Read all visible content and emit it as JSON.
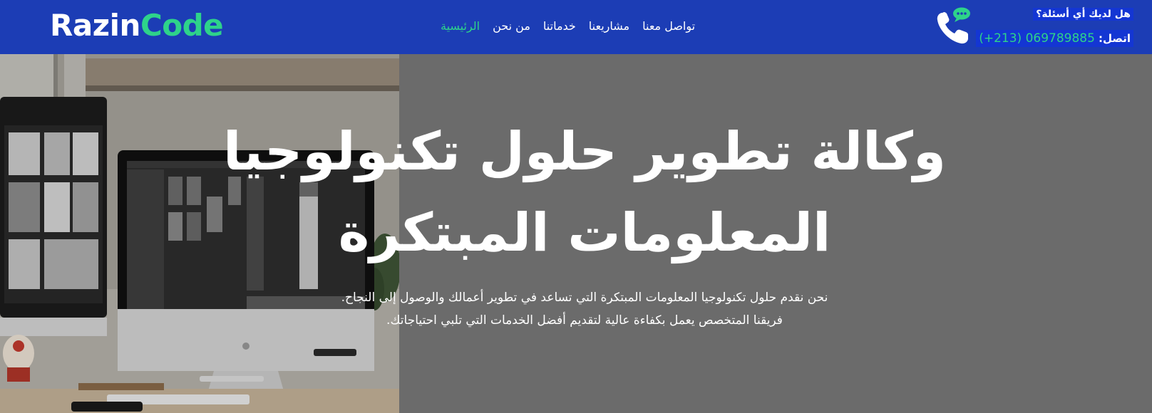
{
  "brand": {
    "logo_part1": "Razin",
    "logo_part2": "Code",
    "accent": "#2ed38a",
    "header_bg": "#1c3db5"
  },
  "nav": {
    "items": [
      {
        "label": "الرئيسية",
        "active": true
      },
      {
        "label": "من نحن",
        "active": false
      },
      {
        "label": "خدماتنا",
        "active": false
      },
      {
        "label": "مشاريعنا",
        "active": false
      },
      {
        "label": "تواصل معنا",
        "active": false
      }
    ]
  },
  "contact": {
    "question": "هل لديك أي أسئلة؟",
    "call_label": "اتصل:",
    "phone": "(+213) 069789885",
    "icons": [
      "phone-icon",
      "chat-bubble-icon"
    ]
  },
  "hero": {
    "title": "وكالة تطوير حلول تكنولوجيا المعلومات المبتكرة",
    "line1": "نحن نقدم حلول تكنولوجيا المعلومات المبتكرة التي تساعد في تطوير أعمالك والوصول إلى النجاح.",
    "line2": "فريقنا المتخصص يعمل بكفاءة عالية لتقديم أفضل الخدمات التي تلبي احتياجاتك."
  }
}
